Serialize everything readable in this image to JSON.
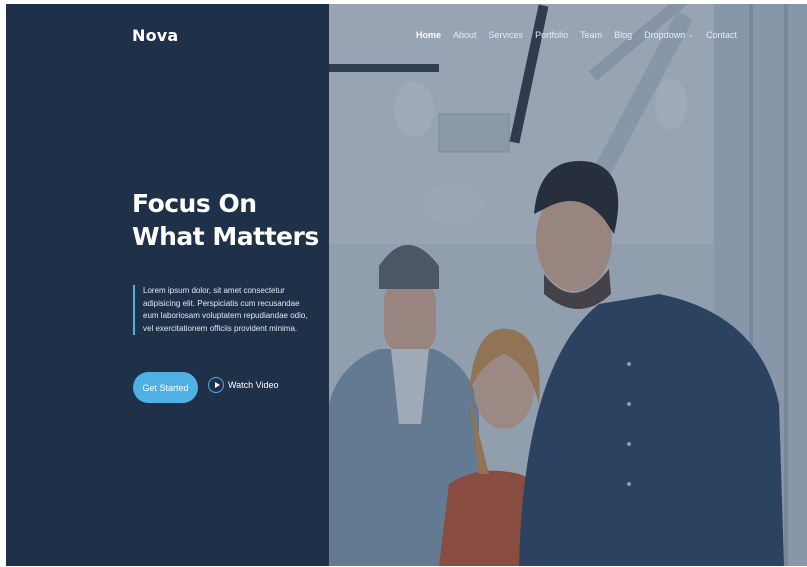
{
  "brand": {
    "logo": "Nova"
  },
  "nav": {
    "items": [
      {
        "label": "Home",
        "active": true
      },
      {
        "label": "About"
      },
      {
        "label": "Services"
      },
      {
        "label": "Portfolio"
      },
      {
        "label": "Team"
      },
      {
        "label": "Blog"
      },
      {
        "label": "Dropdown",
        "has_chevron": true
      },
      {
        "label": "Contact"
      }
    ],
    "chevron_icon": "chevron-down-icon"
  },
  "hero": {
    "title": "Focus On What Matters",
    "text": "Lorem ipsum dolor, sit amet consectetur adipisicing elit. Perspiciatis cum recusandae eum laboriosam voluptatem repudiandae odio, vel exercitationem officiis provident minima.",
    "primary_button": "Get Started",
    "video_link": "Watch Video",
    "video_icon": "play-icon"
  },
  "colors": {
    "panel": "#1e3149",
    "accent": "#4fb0e3",
    "text_light": "#ffffff"
  }
}
